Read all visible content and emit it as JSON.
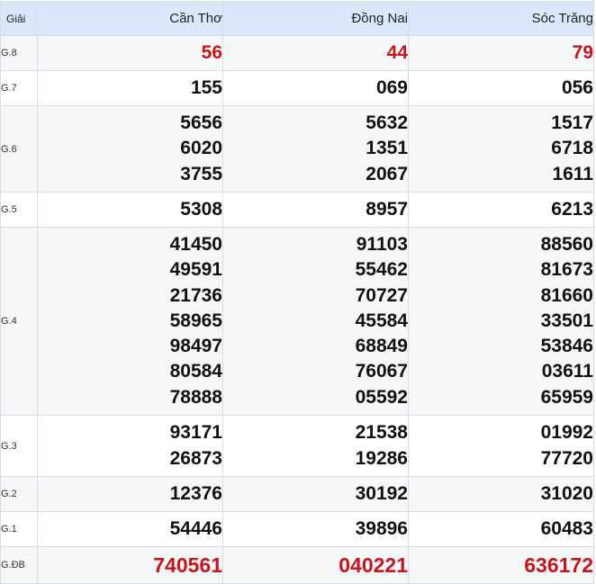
{
  "header": {
    "label": "Giải",
    "provinces": [
      "Cần Thơ",
      "Đồng Nai",
      "Sóc Trăng"
    ]
  },
  "prizes": [
    {
      "label": "G.8",
      "values": [
        [
          "56"
        ],
        [
          "44"
        ],
        [
          "79"
        ]
      ],
      "highlight": true
    },
    {
      "label": "G.7",
      "values": [
        [
          "155"
        ],
        [
          "069"
        ],
        [
          "056"
        ]
      ]
    },
    {
      "label": "G.6",
      "values": [
        [
          "5656",
          "6020",
          "3755"
        ],
        [
          "5632",
          "1351",
          "2067"
        ],
        [
          "1517",
          "6718",
          "1611"
        ]
      ]
    },
    {
      "label": "G.5",
      "values": [
        [
          "5308"
        ],
        [
          "8957"
        ],
        [
          "6213"
        ]
      ]
    },
    {
      "label": "G.4",
      "values": [
        [
          "41450",
          "49591",
          "21736",
          "58965",
          "98497",
          "80584",
          "78888"
        ],
        [
          "91103",
          "55462",
          "70727",
          "45584",
          "68849",
          "76067",
          "05592"
        ],
        [
          "88560",
          "81673",
          "81660",
          "33501",
          "53846",
          "03611",
          "65959"
        ]
      ]
    },
    {
      "label": "G.3",
      "values": [
        [
          "93171",
          "26873"
        ],
        [
          "21538",
          "19286"
        ],
        [
          "01992",
          "77720"
        ]
      ]
    },
    {
      "label": "G.2",
      "values": [
        [
          "12376"
        ],
        [
          "30192"
        ],
        [
          "31020"
        ]
      ]
    },
    {
      "label": "G.1",
      "values": [
        [
          "54446"
        ],
        [
          "39896"
        ],
        [
          "60483"
        ]
      ]
    },
    {
      "label": "G.ĐB",
      "values": [
        [
          "740561"
        ],
        [
          "040221"
        ],
        [
          "636172"
        ]
      ],
      "highlight": true
    }
  ],
  "colors": {
    "header_bg": "#dbe8fb",
    "highlight": "#c4161c",
    "number": "#111111",
    "border": "#d9dde3",
    "alt_row_bg": "#f6f7f9"
  }
}
